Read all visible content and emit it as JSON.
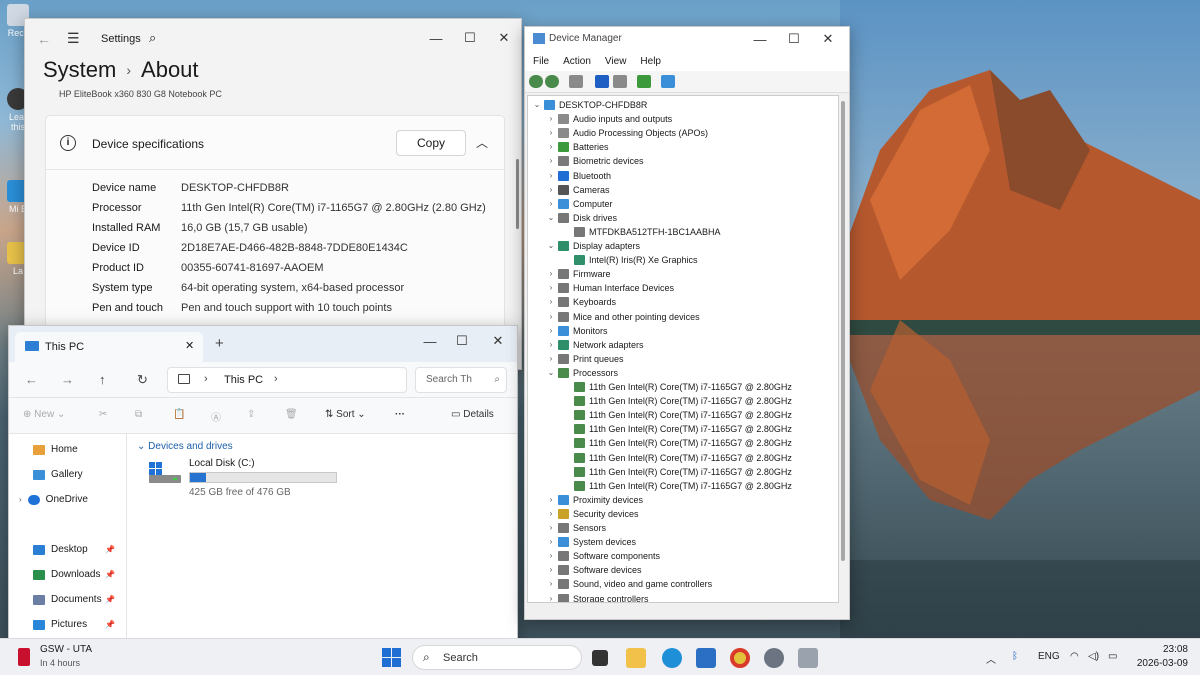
{
  "desktop": {
    "icons": [
      "Recy",
      "Lear this",
      "Mi E",
      "La"
    ]
  },
  "settings": {
    "app_title": "Settings",
    "breadcrumb_parent": "System",
    "breadcrumb_sep": "›",
    "breadcrumb_current": "About",
    "model": "HP EliteBook x360 830 G8 Notebook PC",
    "card_title": "Device specifications",
    "copy_label": "Copy",
    "specs": [
      {
        "key": "Device name",
        "value": "DESKTOP-CHFDB8R"
      },
      {
        "key": "Processor",
        "value": "11th Gen Intel(R) Core(TM) i7-1165G7 @ 2.80GHz (2.80 GHz)"
      },
      {
        "key": "Installed RAM",
        "value": "16,0 GB (15,7 GB usable)"
      },
      {
        "key": "Device ID",
        "value": "2D18E7AE-D466-482B-8848-7DDE80E1434C"
      },
      {
        "key": "Product ID",
        "value": "00355-60741-81697-AAOEM"
      },
      {
        "key": "System type",
        "value": "64-bit operating system, x64-based processor"
      },
      {
        "key": "Pen and touch",
        "value": "Pen and touch support with 10 touch points"
      }
    ]
  },
  "explorer": {
    "tab_label": "This PC",
    "address": "This PC",
    "search_placeholder": "Search Th",
    "new_label": "New",
    "sort_label": "Sort",
    "details_label": "Details",
    "nav_items": [
      {
        "label": "Home",
        "color": "#e8a13a"
      },
      {
        "label": "Gallery",
        "color": "#3a8fd8"
      },
      {
        "label": "OneDrive",
        "color": "#1f72d6"
      },
      {
        "label": "Desktop",
        "color": "#2a7fd4"
      },
      {
        "label": "Downloads",
        "color": "#2a8f4a"
      },
      {
        "label": "Documents",
        "color": "#6a7fa3"
      },
      {
        "label": "Pictures",
        "color": "#2a86d8"
      }
    ],
    "section_label": "Devices and drives",
    "drive": {
      "name": "Local Disk (C:)",
      "free_text": "425 GB free of 476 GB",
      "used_fraction": 0.107
    }
  },
  "devmgr": {
    "title": "Device Manager",
    "menu": [
      "File",
      "Action",
      "View",
      "Help"
    ],
    "root": "DESKTOP-CHFDB8R",
    "nodes": [
      {
        "label": "Audio inputs and outputs",
        "level": 1,
        "state": "collapsed",
        "color": "#8a8a8a"
      },
      {
        "label": "Audio Processing Objects (APOs)",
        "level": 1,
        "state": "collapsed",
        "color": "#8a8a8a"
      },
      {
        "label": "Batteries",
        "level": 1,
        "state": "collapsed",
        "color": "#3c9a3c"
      },
      {
        "label": "Biometric devices",
        "level": 1,
        "state": "collapsed",
        "color": "#7a7a7a"
      },
      {
        "label": "Bluetooth",
        "level": 1,
        "state": "collapsed",
        "color": "#1f6ed4"
      },
      {
        "label": "Cameras",
        "level": 1,
        "state": "collapsed",
        "color": "#555555"
      },
      {
        "label": "Computer",
        "level": 1,
        "state": "collapsed",
        "color": "#3a8fd8"
      },
      {
        "label": "Disk drives",
        "level": 1,
        "state": "expanded",
        "color": "#777777"
      },
      {
        "label": "MTFDKBA512TFH-1BC1AABHA",
        "level": 2,
        "state": "leaf",
        "color": "#777777"
      },
      {
        "label": "Display adapters",
        "level": 1,
        "state": "expanded",
        "color": "#2f8f6a"
      },
      {
        "label": "Intel(R) Iris(R) Xe Graphics",
        "level": 2,
        "state": "leaf",
        "color": "#2f8f6a"
      },
      {
        "label": "Firmware",
        "level": 1,
        "state": "collapsed",
        "color": "#777777"
      },
      {
        "label": "Human Interface Devices",
        "level": 1,
        "state": "collapsed",
        "color": "#777777"
      },
      {
        "label": "Keyboards",
        "level": 1,
        "state": "collapsed",
        "color": "#777777"
      },
      {
        "label": "Mice and other pointing devices",
        "level": 1,
        "state": "collapsed",
        "color": "#777777"
      },
      {
        "label": "Monitors",
        "level": 1,
        "state": "collapsed",
        "color": "#3a8fd8"
      },
      {
        "label": "Network adapters",
        "level": 1,
        "state": "collapsed",
        "color": "#2f8f6a"
      },
      {
        "label": "Print queues",
        "level": 1,
        "state": "collapsed",
        "color": "#777777"
      },
      {
        "label": "Processors",
        "level": 1,
        "state": "expanded",
        "color": "#4a8a4a"
      },
      {
        "label": "11th Gen Intel(R) Core(TM) i7-1165G7 @ 2.80GHz",
        "level": 2,
        "state": "leaf",
        "color": "#4a8a4a"
      },
      {
        "label": "11th Gen Intel(R) Core(TM) i7-1165G7 @ 2.80GHz",
        "level": 2,
        "state": "leaf",
        "color": "#4a8a4a"
      },
      {
        "label": "11th Gen Intel(R) Core(TM) i7-1165G7 @ 2.80GHz",
        "level": 2,
        "state": "leaf",
        "color": "#4a8a4a"
      },
      {
        "label": "11th Gen Intel(R) Core(TM) i7-1165G7 @ 2.80GHz",
        "level": 2,
        "state": "leaf",
        "color": "#4a8a4a"
      },
      {
        "label": "11th Gen Intel(R) Core(TM) i7-1165G7 @ 2.80GHz",
        "level": 2,
        "state": "leaf",
        "color": "#4a8a4a"
      },
      {
        "label": "11th Gen Intel(R) Core(TM) i7-1165G7 @ 2.80GHz",
        "level": 2,
        "state": "leaf",
        "color": "#4a8a4a"
      },
      {
        "label": "11th Gen Intel(R) Core(TM) i7-1165G7 @ 2.80GHz",
        "level": 2,
        "state": "leaf",
        "color": "#4a8a4a"
      },
      {
        "label": "11th Gen Intel(R) Core(TM) i7-1165G7 @ 2.80GHz",
        "level": 2,
        "state": "leaf",
        "color": "#4a8a4a"
      },
      {
        "label": "Proximity devices",
        "level": 1,
        "state": "collapsed",
        "color": "#3a8fd8"
      },
      {
        "label": "Security devices",
        "level": 1,
        "state": "collapsed",
        "color": "#c9a227"
      },
      {
        "label": "Sensors",
        "level": 1,
        "state": "collapsed",
        "color": "#777777"
      },
      {
        "label": "System devices",
        "level": 1,
        "state": "collapsed",
        "color": "#3a8fd8"
      },
      {
        "label": "Software components",
        "level": 1,
        "state": "collapsed",
        "color": "#777777"
      },
      {
        "label": "Software devices",
        "level": 1,
        "state": "collapsed",
        "color": "#777777"
      },
      {
        "label": "Sound, video and game controllers",
        "level": 1,
        "state": "collapsed",
        "color": "#777777"
      },
      {
        "label": "Storage controllers",
        "level": 1,
        "state": "collapsed",
        "color": "#777777"
      }
    ]
  },
  "taskbar": {
    "weather_title": "GSW - UTA",
    "weather_sub": "In 4 hours",
    "search_placeholder": "Search",
    "lang": "ENG",
    "time": "23:08",
    "date": "2026-03-09"
  }
}
